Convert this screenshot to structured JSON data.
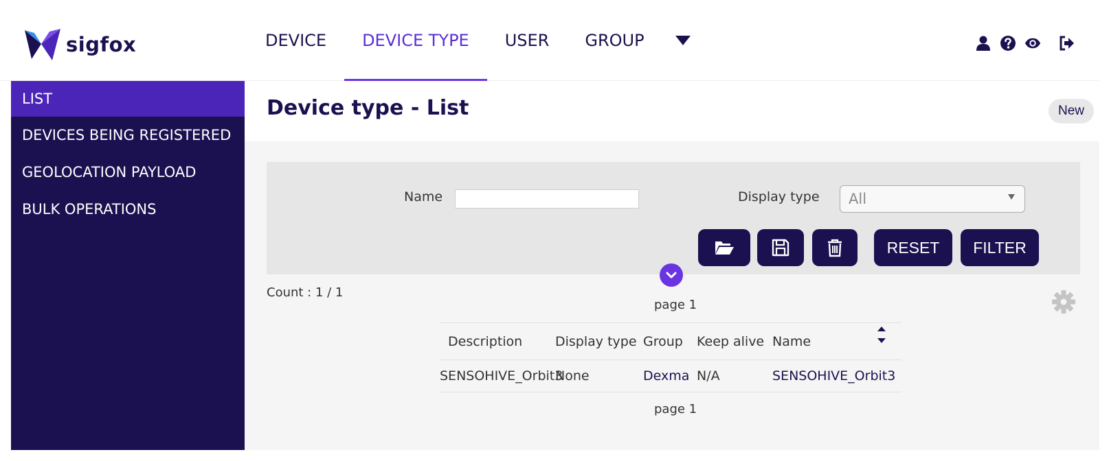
{
  "brand": {
    "name": "sigfox",
    "primary": "#1b1150",
    "accent": "#6a35e0"
  },
  "nav": {
    "tabs": [
      {
        "label": "DEVICE",
        "active": false
      },
      {
        "label": "DEVICE TYPE",
        "active": true
      },
      {
        "label": "USER",
        "active": false
      },
      {
        "label": "GROUP",
        "active": false
      }
    ],
    "more_icon": "chevron-down-icon"
  },
  "header_icons": [
    "user-icon",
    "help-icon",
    "eye-icon",
    "logout-icon"
  ],
  "sidebar": {
    "items": [
      {
        "label": "LIST",
        "active": true
      },
      {
        "label": "DEVICES BEING REGISTERED",
        "active": false
      },
      {
        "label": "GEOLOCATION PAYLOAD",
        "active": false
      },
      {
        "label": "BULK OPERATIONS",
        "active": false
      }
    ]
  },
  "page": {
    "title": "Device type - List",
    "new_label": "New"
  },
  "filter": {
    "name_label": "Name",
    "name_value": "",
    "display_type_label": "Display type",
    "display_type_value": "All",
    "reset_label": "RESET",
    "filter_label": "FILTER",
    "icons": [
      "folder-open-icon",
      "save-icon",
      "trash-icon"
    ]
  },
  "results": {
    "count_text": "Count : 1 / 1",
    "page_top": "page 1",
    "page_bottom": "page 1",
    "columns": [
      "Description",
      "Display type",
      "Group",
      "Keep alive",
      "Name"
    ],
    "rows": [
      {
        "description": "SENSOHIVE_Orbit3",
        "display_type": "None",
        "group": "Dexma",
        "keep_alive": "N/A",
        "name": "SENSOHIVE_Orbit3"
      }
    ]
  }
}
